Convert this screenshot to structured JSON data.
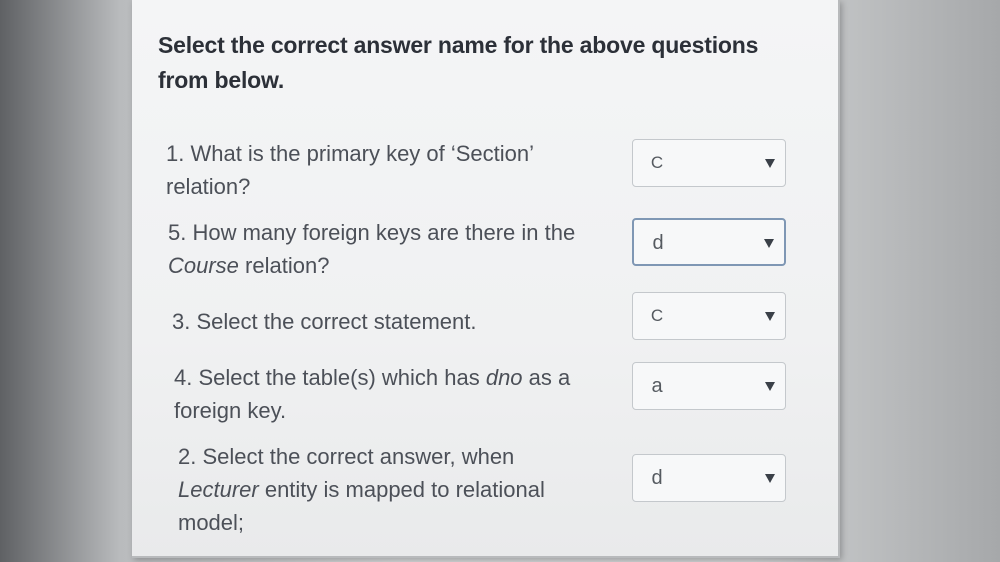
{
  "heading": "Select the correct answer name for the above questions from below.",
  "questions": [
    {
      "text_before": "1. What is the primary key of ‘Section’ relation?",
      "emph": "",
      "text_after": "",
      "selected": "C"
    },
    {
      "text_before": "5. How many foreign keys are there in the ",
      "emph": "Course",
      "text_after": " relation?",
      "selected": "d"
    },
    {
      "text_before": "3. Select the correct statement.",
      "emph": "",
      "text_after": "",
      "selected": "C"
    },
    {
      "text_before": "4. Select the table(s) which has ",
      "emph": "dno",
      "text_after": " as a foreign key.",
      "selected": "a"
    },
    {
      "text_before": "2. Select the correct answer, when ",
      "emph": "Lecturer",
      "text_after": " entity is mapped to relational model;",
      "selected": "d"
    }
  ],
  "dropdown_icon": "triangle-down-icon"
}
